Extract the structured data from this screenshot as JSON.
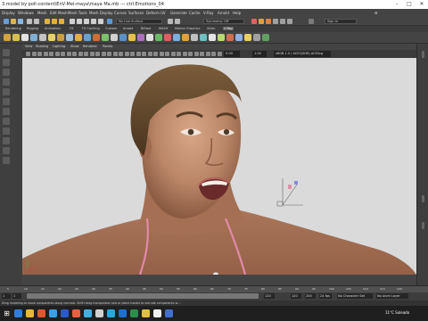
{
  "window": {
    "title": "3.model by poll-content\\EnV-Mel-maya\\maya Ma.mb --- ctrl:Emotions_04",
    "controls": [
      "–",
      "□",
      "✕"
    ]
  },
  "menubar": {
    "items": [
      "Display",
      "Windows",
      "Mesh",
      "Edit Mesh",
      "Mesh Tools",
      "Mesh Display",
      "Curves",
      "Surfaces",
      "Deform",
      "UV",
      "Generate",
      "Cache",
      "V-Ray",
      "Arnold",
      "Help"
    ],
    "live_surface": "No Live Surface",
    "symmetry": "Symmetry: Off",
    "signin": "Sign In"
  },
  "shelf": {
    "tabs": [
      "Rendering",
      "Rigging",
      "Animation",
      "FX",
      "FX Caching",
      "Custom",
      "Arnold",
      "Bifrost",
      "MASH",
      "Motion Graphics",
      "XGen",
      "V-Ray"
    ],
    "active_tab": "V-Ray",
    "icon_colors": [
      "#d4a43a",
      "#d8c04a",
      "#e2e2e2",
      "#7fb0d8",
      "#c4c4c4",
      "#e6d46a",
      "#c9a03c",
      "#9ec0df",
      "#e0b040",
      "#6aa0d0",
      "#cf6a3a",
      "#7bc06a",
      "#d0d0d0",
      "#5a90c8",
      "#e6c24a",
      "#b070c0",
      "#e0e0e0",
      "#68b868",
      "#d86060",
      "#7ab0e0",
      "#e0a040",
      "#c0c0c0",
      "#70c0c0",
      "#e5e5e5",
      "#b8d870",
      "#d07050",
      "#90b0e0",
      "#e8d060",
      "#a0a0a0",
      "#60a060"
    ]
  },
  "viewport": {
    "menu": [
      "View",
      "Shading",
      "Lighting",
      "Show",
      "Renderer",
      "Panels"
    ],
    "field_values": [
      "0.00",
      "1.00"
    ],
    "color_space": "sRGB 1.0 / ACES(SDR) ACEScg",
    "background_color": "#d9d9d9",
    "axis_labels": [
      "y",
      "x"
    ]
  },
  "timeline": {
    "ticks": [
      "5",
      "10",
      "15",
      "20",
      "25",
      "30",
      "35",
      "40",
      "45",
      "50",
      "55",
      "60",
      "65",
      "70",
      "75",
      "80",
      "85",
      "90",
      "95",
      "100",
      "105",
      "110",
      "115",
      "120"
    ]
  },
  "range": {
    "start": "1",
    "inner_start": "1",
    "inner_end": "120",
    "end": "120",
    "end2": "200",
    "fps": "24 fps",
    "character_set": "No Character Set",
    "anim_layer": "No Anim Layer"
  },
  "helpline": {
    "text": "Drag modeling to move components along normals. Shift+drag manipulator axis or plane handle to extrude components or..."
  },
  "taskbar": {
    "icon_colors": [
      "#2f7fd8",
      "#e8b830",
      "#e0562e",
      "#3ca0e0",
      "#2a5ad0",
      "#e86040",
      "#40b0e8",
      "#d0d0d0",
      "#27a8e0",
      "#1e6fd0",
      "#2b8f4a",
      "#e0c040",
      "#f0f0f0",
      "#4070d0"
    ],
    "weather": "11°C  Soleado",
    "search_placeholder": ""
  }
}
